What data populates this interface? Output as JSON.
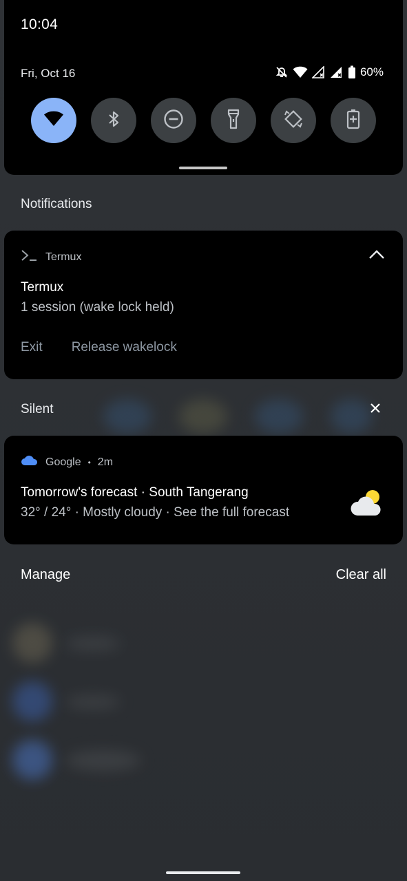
{
  "status": {
    "time": "10:04",
    "date": "Fri, Oct 16",
    "battery": "60%"
  },
  "quick_settings": [
    {
      "name": "wifi-icon",
      "active": true
    },
    {
      "name": "bluetooth-icon",
      "active": false
    },
    {
      "name": "do-not-disturb-icon",
      "active": false
    },
    {
      "name": "flashlight-icon",
      "active": false
    },
    {
      "name": "auto-rotate-icon",
      "active": false
    },
    {
      "name": "battery-saver-icon",
      "active": false
    }
  ],
  "notifications_header": "Notifications",
  "termux": {
    "app_name": "Termux",
    "title": "Termux",
    "text": "1 session (wake lock held)",
    "actions": [
      "Exit",
      "Release wakelock"
    ]
  },
  "silent_header": "Silent",
  "google": {
    "app_name": "Google",
    "separator": "•",
    "time": "2m",
    "title": "Tomorrow's forecast · South Tangerang",
    "text": "32° / 24° · Mostly cloudy · See the full forecast"
  },
  "footer": {
    "manage": "Manage",
    "clear_all": "Clear all"
  },
  "colors": {
    "accent": "#8ab4f8",
    "panel": "#000000",
    "tile": "#3c4043",
    "cloud_blue": "#4f8ef7"
  }
}
